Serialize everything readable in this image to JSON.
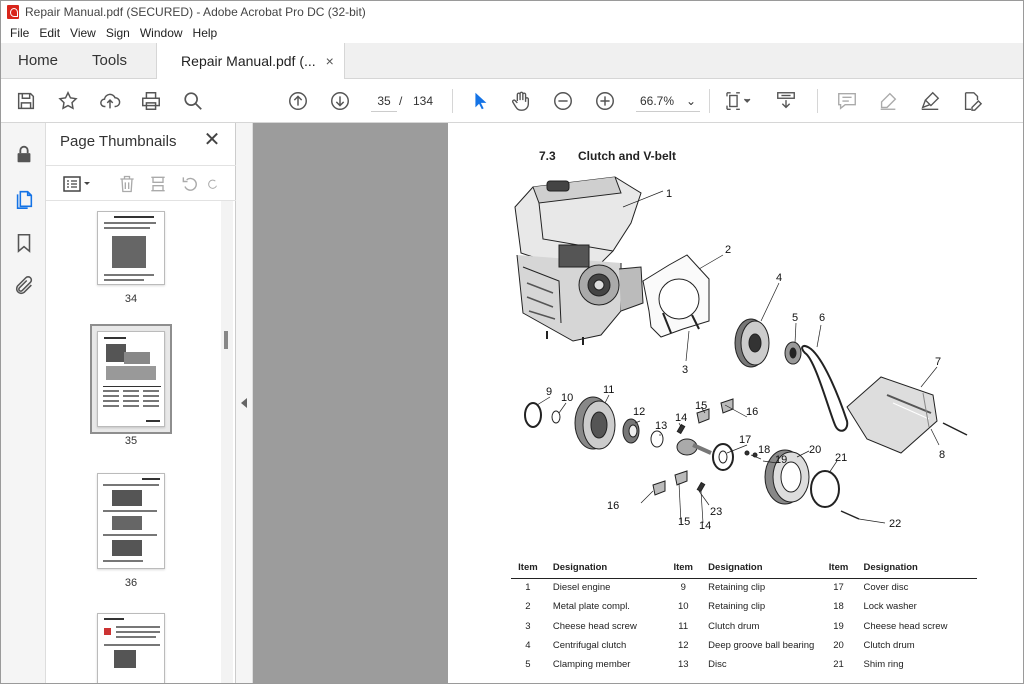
{
  "window": {
    "title": "Repair Manual.pdf (SECURED) - Adobe Acrobat Pro DC (32-bit)"
  },
  "menu": [
    "File",
    "Edit",
    "View",
    "Sign",
    "Window",
    "Help"
  ],
  "tabs": {
    "home": "Home",
    "tools": "Tools",
    "document": "Repair Manual.pdf (...",
    "close": "×"
  },
  "toolbar": {
    "current_page": "35",
    "page_separator": "/",
    "total_pages": "134",
    "zoom": "66.7%",
    "icons": [
      "save-icon",
      "bookmark-star-icon",
      "upload-cloud-icon",
      "print-icon",
      "search-zoom-icon",
      "page-up-icon",
      "page-down-icon",
      "select-pointer-icon",
      "hand-tool-icon",
      "zoom-out-icon",
      "zoom-in-icon",
      "page-fit-icon",
      "scroll-mode-icon",
      "comment-icon",
      "highlight-icon",
      "sign-icon",
      "edit-pdf-icon"
    ]
  },
  "left_rail": {
    "icons": [
      "lock-icon",
      "pages-icon",
      "bookmark-icon",
      "attachment-icon"
    ]
  },
  "thumbnails_panel": {
    "title": "Page Thumbnails",
    "close": "✕",
    "pages": [
      {
        "number": "34"
      },
      {
        "number": "35"
      },
      {
        "number": "36"
      }
    ]
  },
  "document": {
    "section_number": "7.3",
    "section_title": "Clutch and V-belt",
    "callouts": [
      "1",
      "2",
      "3",
      "4",
      "5",
      "6",
      "7",
      "8",
      "9",
      "10",
      "11",
      "12",
      "13",
      "14",
      "15",
      "16",
      "17",
      "18",
      "19",
      "20",
      "21",
      "22",
      "23",
      "16",
      "15",
      "14"
    ],
    "table": {
      "headers": [
        "Item",
        "Designation",
        "Item",
        "Designation",
        "Item",
        "Designation"
      ],
      "rows": [
        [
          "1",
          "Diesel engine",
          "9",
          "Retaining clip",
          "17",
          "Cover disc"
        ],
        [
          "2",
          "Metal plate compl.",
          "10",
          "Retaining clip",
          "18",
          "Lock washer"
        ],
        [
          "3",
          "Cheese head screw",
          "11",
          "Clutch drum",
          "19",
          "Cheese head screw"
        ],
        [
          "4",
          "Centrifugal clutch",
          "12",
          "Deep groove ball bearing",
          "20",
          "Clutch drum"
        ],
        [
          "5",
          "Clamping member",
          "13",
          "Disc",
          "21",
          "Shim ring"
        ]
      ]
    }
  }
}
